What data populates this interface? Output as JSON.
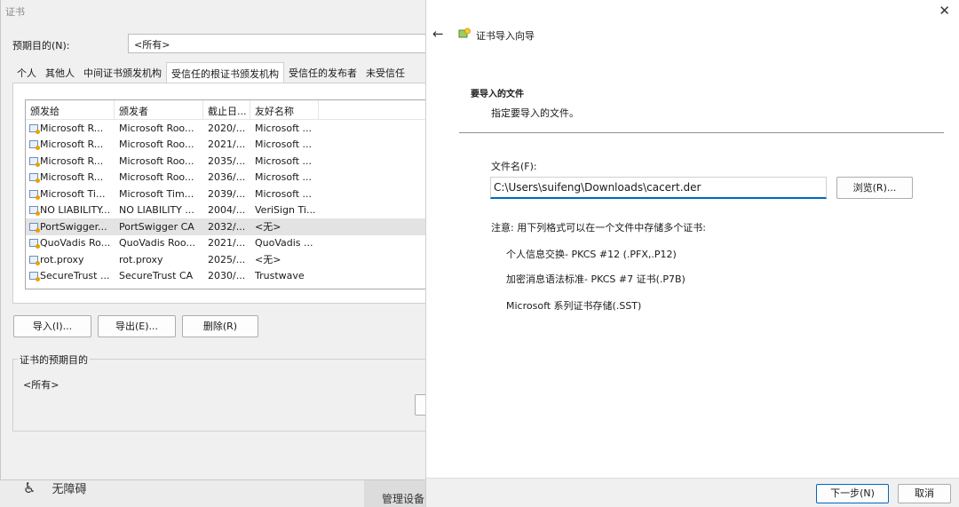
{
  "background": {
    "accessibility_label": "无障碍",
    "manage_label": "管理设备"
  },
  "cert_window": {
    "title": "证书",
    "purpose_label": "预期目的(N):",
    "purpose_value": "<所有>",
    "tabs": [
      "个人",
      "其他人",
      "中间证书颁发机构",
      "受信任的根证书颁发机构",
      "受信任的发布者",
      "未受信任"
    ],
    "active_tab": "受信任的根证书颁发机构",
    "columns": [
      "颁发给",
      "颁发者",
      "截止日...",
      "友好名称"
    ],
    "rows": [
      [
        "Microsoft R...",
        "Microsoft Roo...",
        "2020/...",
        "Microsoft ..."
      ],
      [
        "Microsoft R...",
        "Microsoft Roo...",
        "2021/...",
        "Microsoft ..."
      ],
      [
        "Microsoft R...",
        "Microsoft Roo...",
        "2035/...",
        "Microsoft ..."
      ],
      [
        "Microsoft R...",
        "Microsoft Roo...",
        "2036/...",
        "Microsoft ..."
      ],
      [
        "Microsoft Ti...",
        "Microsoft Tim...",
        "2039/...",
        "Microsoft ..."
      ],
      [
        "NO LIABILITY...",
        "NO LIABILITY ...",
        "2004/...",
        "VeriSign Ti..."
      ],
      [
        "PortSwigger...",
        "PortSwigger CA",
        "2032/...",
        "<无>"
      ],
      [
        "QuoVadis Ro...",
        "QuoVadis Roo...",
        "2021/...",
        "QuoVadis ..."
      ],
      [
        "rot.proxy",
        "rot.proxy",
        "2025/...",
        "<无>"
      ],
      [
        "SecureTrust ...",
        "SecureTrust CA",
        "2030/...",
        "Trustwave"
      ]
    ],
    "selected_row": "PortSwigger...",
    "import_label": "导入(I)...",
    "export_label": "导出(E)...",
    "delete_label": "删除(R)",
    "purposes_title": "证书的预期目的",
    "purposes_value": "<所有>"
  },
  "wizard": {
    "title": "证书导入向导",
    "section_title": "要导入的文件",
    "section_sub": "指定要导入的文件。",
    "file_label": "文件名(F):",
    "file_value": "C:\\Users\\suifeng\\Downloads\\cacert.der",
    "browse_label": "浏览(R)...",
    "note": "注意: 用下列格式可以在一个文件中存储多个证书:",
    "formats": [
      "个人信息交换- PKCS #12 (.PFX,.P12)",
      "加密消息语法标准- PKCS #7 证书(.P7B)",
      "Microsoft 系列证书存储(.SST)"
    ],
    "next_label": "下一步(N)",
    "cancel_label": "取消"
  },
  "icons": {
    "back": "back-arrow-icon",
    "close": "close-icon",
    "wizard": "certificate-wizard-icon",
    "cert": "certificate-icon",
    "accessibility": "accessibility-icon"
  },
  "colors": {
    "accent": "#0067c0",
    "selection": "#e3e3e3"
  }
}
